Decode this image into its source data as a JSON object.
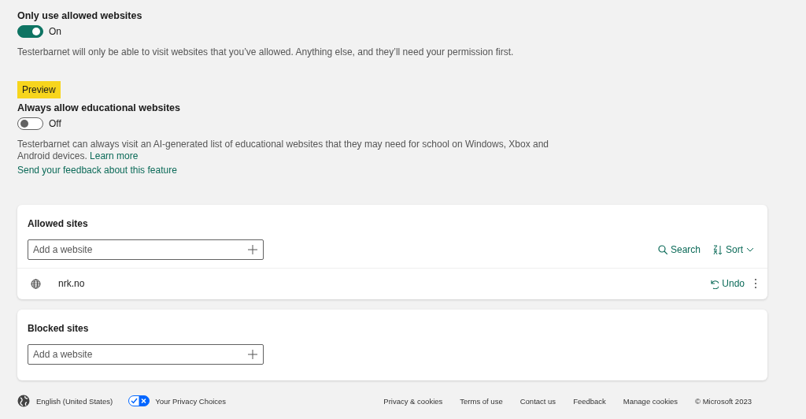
{
  "settings": [
    {
      "title": "Only use allowed websites",
      "toggle": {
        "on": true,
        "label": "On"
      },
      "description": "Testerbarnet will only be able to visit websites that you’ve allowed. Anything else, and they’ll need your permission first."
    },
    {
      "badge": "Preview",
      "title": "Always allow educational websites",
      "toggle": {
        "on": false,
        "label": "Off"
      },
      "description": "Testerbarnet can always visit an AI-generated list of educational websites that they may need for school on Windows, Xbox and Android devices.",
      "learn_more": "Learn more",
      "feedback_link": "Send your feedback about this feature"
    }
  ],
  "lists": [
    {
      "title": "Allowed sites",
      "input": {
        "placeholder": "Add a website"
      },
      "tools": [
        {
          "kind": "search",
          "label": "Search"
        },
        {
          "kind": "sort",
          "label": "Sort"
        }
      ],
      "sites": [
        {
          "domain": "nrk.no",
          "action": "Undo"
        }
      ]
    },
    {
      "title": "Blocked sites",
      "input": {
        "placeholder": "Add a website"
      }
    }
  ],
  "footer": {
    "language": "English (United States)",
    "privacy_choices": "Your Privacy Choices",
    "links": [
      "Privacy & cookies",
      "Terms of use",
      "Contact us",
      "Feedback",
      "Manage cookies"
    ],
    "copyright": "© Microsoft 2023"
  }
}
